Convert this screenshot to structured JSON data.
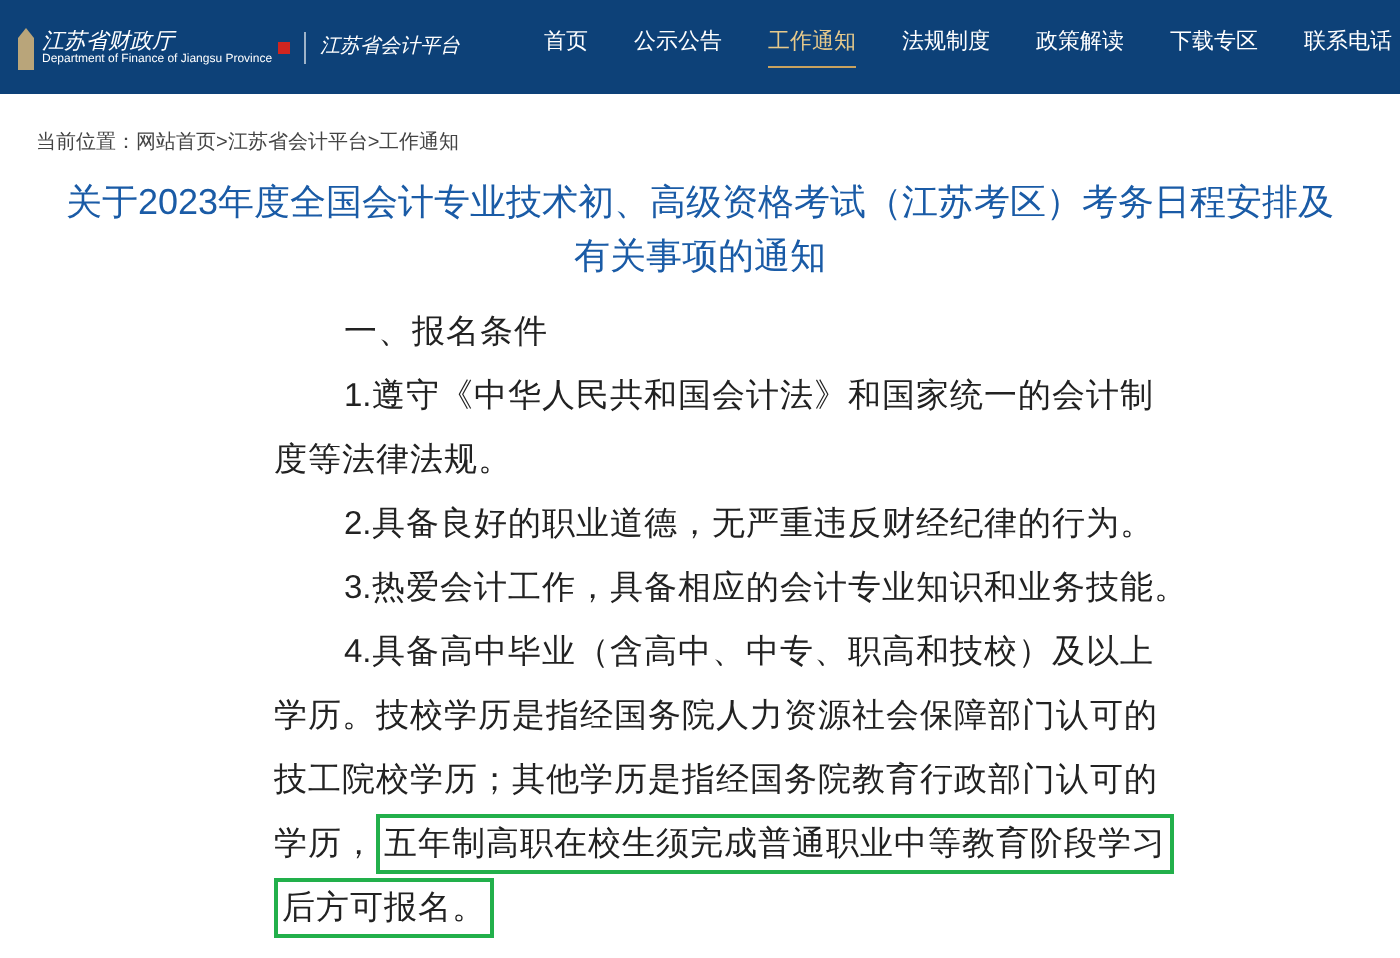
{
  "header": {
    "logo_title": "江苏省财政厅",
    "logo_subtitle": "Department of Finance of Jiangsu Province",
    "platform": "江苏省会计平台",
    "nav": [
      {
        "label": "首页",
        "selected": false
      },
      {
        "label": "公示公告",
        "selected": false
      },
      {
        "label": "工作通知",
        "selected": true
      },
      {
        "label": "法规制度",
        "selected": false
      },
      {
        "label": "政策解读",
        "selected": false
      },
      {
        "label": "下载专区",
        "selected": false
      },
      {
        "label": "联系电话",
        "selected": false
      }
    ]
  },
  "breadcrumb": "当前位置：网站首页>江苏省会计平台>工作通知",
  "article": {
    "title": "关于2023年度全国会计专业技术初、高级资格考试（江苏考区）考务日程安排及有关事项的通知",
    "paragraphs": [
      {
        "lines": [
          [
            {
              "text": "一、报名条件",
              "highlighted": false
            }
          ]
        ]
      },
      {
        "lines": [
          [
            {
              "text": "1.遵守《中华人民共和国会计法》和国家统一的会计制",
              "highlighted": false
            }
          ],
          [
            {
              "text": "度等法律法规。",
              "highlighted": false
            }
          ]
        ]
      },
      {
        "lines": [
          [
            {
              "text": "2.具备良好的职业道德，无严重违反财经纪律的行为。",
              "highlighted": false
            }
          ]
        ]
      },
      {
        "lines": [
          [
            {
              "text": "3.热爱会计工作，具备相应的会计专业知识和业务技能。",
              "highlighted": false
            }
          ]
        ]
      },
      {
        "lines": [
          [
            {
              "text": "4.具备高中毕业（含高中、中专、职高和技校）及以上",
              "highlighted": false
            }
          ],
          [
            {
              "text": "学历。技校学历是指经国务院人力资源社会保障部门认可的",
              "highlighted": false
            }
          ],
          [
            {
              "text": "技工院校学历；其他学历是指经国务院教育行政部门认可的",
              "highlighted": false
            }
          ],
          [
            {
              "text": "学历，",
              "highlighted": false
            },
            {
              "text": "五年制高职在校生须完成普通职业中等教育阶段学习",
              "highlighted": true
            }
          ],
          [
            {
              "text": "后方可报名。",
              "highlighted": true
            }
          ]
        ]
      }
    ]
  }
}
